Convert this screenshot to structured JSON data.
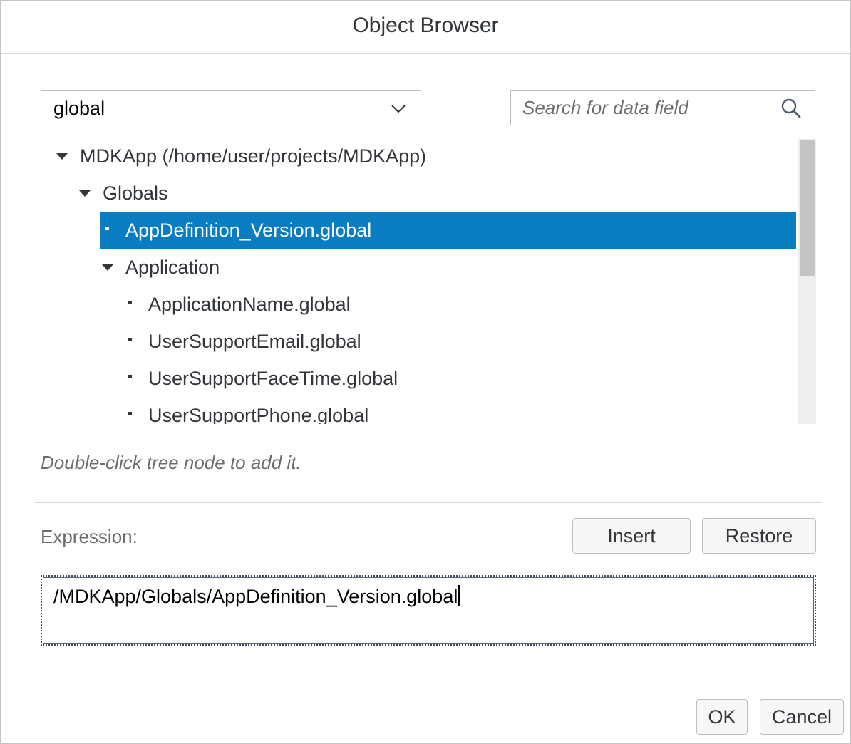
{
  "dialog": {
    "title": "Object Browser"
  },
  "scope_select": {
    "value": "global"
  },
  "search": {
    "placeholder": "Search for data field"
  },
  "tree": {
    "nodes": [
      {
        "label": "MDKApp (/home/user/projects/MDKApp)",
        "expanded": true,
        "level": 0
      },
      {
        "label": "Globals",
        "expanded": true,
        "level": 1
      },
      {
        "label": "AppDefinition_Version.global",
        "leaf": true,
        "selected": true,
        "level": 2
      },
      {
        "label": "Application",
        "expanded": true,
        "level": 2
      },
      {
        "label": "ApplicationName.global",
        "leaf": true,
        "level": 3
      },
      {
        "label": "UserSupportEmail.global",
        "leaf": true,
        "level": 3
      },
      {
        "label": "UserSupportFaceTime.global",
        "leaf": true,
        "level": 3
      },
      {
        "label": "UserSupportPhone.global",
        "leaf": true,
        "level": 3
      }
    ]
  },
  "hint": "Double-click tree node to add it.",
  "expression": {
    "label": "Expression:",
    "insert_label": "Insert",
    "restore_label": "Restore",
    "value": "/MDKApp/Globals/AppDefinition_Version.global"
  },
  "footer": {
    "ok_label": "OK",
    "cancel_label": "Cancel"
  },
  "colors": {
    "selection": "#0a7dc2",
    "text": "#32363a",
    "muted": "#6a6d70"
  }
}
